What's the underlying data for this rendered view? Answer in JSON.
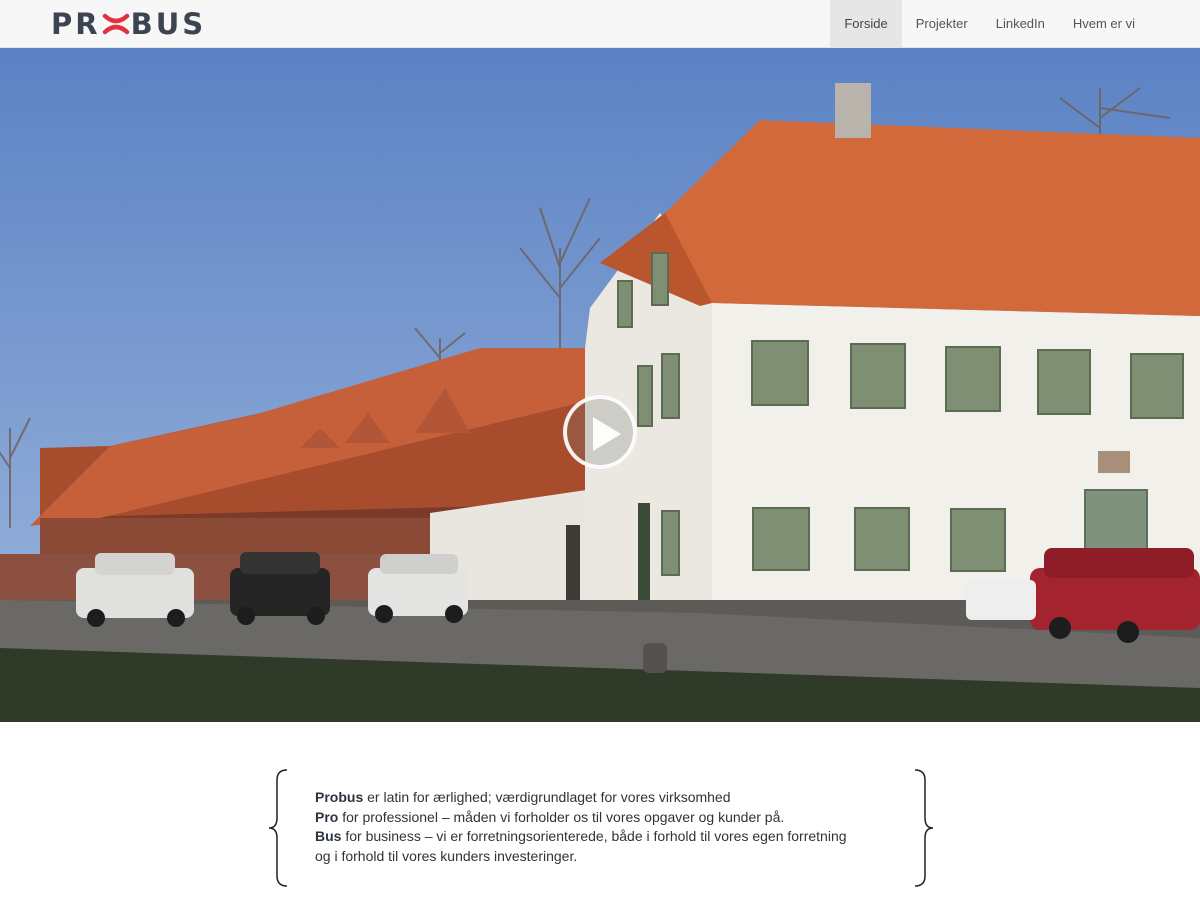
{
  "header": {
    "logo_text": "PROBUS",
    "nav": [
      {
        "label": "Forside",
        "active": true
      },
      {
        "label": "Projekter",
        "active": false
      },
      {
        "label": "LinkedIn",
        "active": false
      },
      {
        "label": "Hvem er vi",
        "active": false
      }
    ]
  },
  "hero": {
    "play_icon": "play-icon"
  },
  "intro": {
    "line1_bold": "Probus",
    "line1_rest": " er latin for ærlighed; værdigrundlaget for vores virksomhed",
    "line2_bold": "Pro",
    "line2_rest": " for professionel – måden vi forholder os til vores opgaver og kunder på.",
    "line3_bold": "Bus",
    "line3_rest": " for business – vi er forretningsorienterede, både i forhold til vores egen forretning",
    "line4": "og i forhold til vores kunders investeringer."
  },
  "colors": {
    "brand_dark": "#3d4451",
    "brand_red": "#e0323f",
    "nav_active_bg": "#e6e6e6"
  }
}
